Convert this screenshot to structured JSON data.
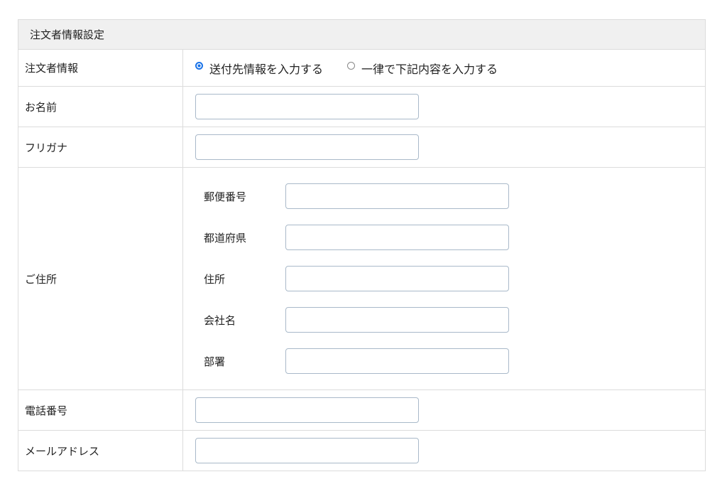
{
  "section": {
    "title": "注文者情報設定"
  },
  "rows": {
    "orderer_info": {
      "label": "注文者情報",
      "options": [
        {
          "label": "送付先情報を入力する",
          "selected": true
        },
        {
          "label": "一律で下記内容を入力する",
          "selected": false
        }
      ]
    },
    "name": {
      "label": "お名前",
      "value": ""
    },
    "furigana": {
      "label": "フリガナ",
      "value": ""
    },
    "address": {
      "label": "ご住所",
      "fields": [
        {
          "label": "郵便番号",
          "value": ""
        },
        {
          "label": "都道府県",
          "value": ""
        },
        {
          "label": "住所",
          "value": ""
        },
        {
          "label": "会社名",
          "value": ""
        },
        {
          "label": "部署",
          "value": ""
        }
      ]
    },
    "phone": {
      "label": "電話番号",
      "value": ""
    },
    "email": {
      "label": "メールアドレス",
      "value": ""
    }
  },
  "colors": {
    "header_bg": "#f0f0f0",
    "border": "#dcdcdc",
    "input_border": "#a9b9c9",
    "radio_accent": "#1a73e8"
  },
  "icons": {
    "radio_checked": "radio-checked-icon",
    "radio_unchecked": "radio-unchecked-icon"
  }
}
